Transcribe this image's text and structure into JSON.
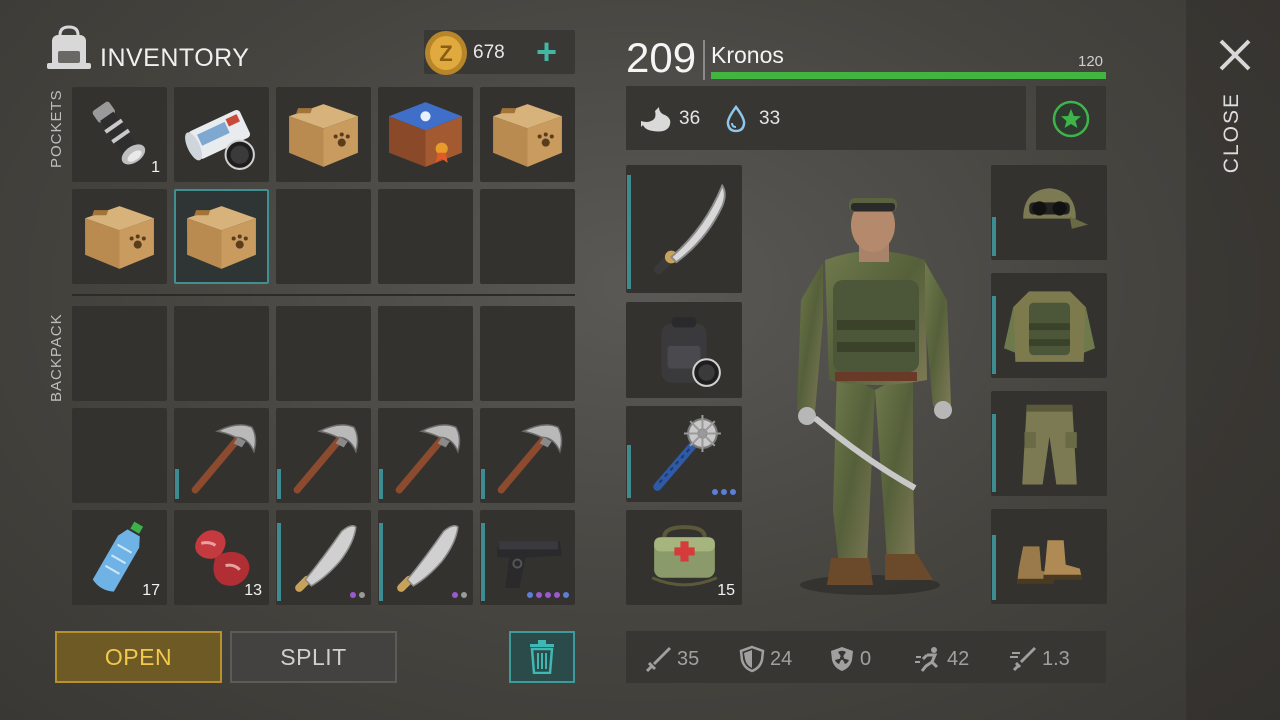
{
  "inventory": {
    "title": "INVENTORY",
    "pockets_label": "POCKETS",
    "backpack_label": "BACKPACK",
    "coins": "678",
    "coin_glyph": "Z",
    "pockets": [
      {
        "item": "flashlight-icon",
        "count": "1"
      },
      {
        "item": "map-scroll-icon",
        "count": ""
      },
      {
        "item": "cardboard-box-icon",
        "count": ""
      },
      {
        "item": "blue-crate-icon",
        "count": ""
      },
      {
        "item": "cardboard-box-icon",
        "count": ""
      },
      {
        "item": "cardboard-box-icon",
        "count": ""
      },
      {
        "item": "cardboard-box-icon",
        "count": "",
        "selected": true
      },
      {
        "item": "",
        "count": ""
      },
      {
        "item": "",
        "count": ""
      },
      {
        "item": "",
        "count": ""
      }
    ],
    "backpack": [
      {
        "item": "",
        "count": ""
      },
      {
        "item": "",
        "count": ""
      },
      {
        "item": "",
        "count": ""
      },
      {
        "item": "",
        "count": ""
      },
      {
        "item": "",
        "count": ""
      },
      {
        "item": "",
        "count": ""
      },
      {
        "item": "pickaxe-icon",
        "count": "",
        "durability": 0.35
      },
      {
        "item": "pickaxe-icon",
        "count": "",
        "durability": 0.35
      },
      {
        "item": "pickaxe-icon",
        "count": "",
        "durability": 0.35
      },
      {
        "item": "pickaxe-icon",
        "count": "",
        "durability": 0.35
      },
      {
        "item": "water-bottle-icon",
        "count": "17"
      },
      {
        "item": "raw-meat-icon",
        "count": "13"
      },
      {
        "item": "machete-icon",
        "count": "",
        "durability": 0.9,
        "dots": [
          "#9b59d0",
          "#9a9a9a"
        ]
      },
      {
        "item": "machete-icon",
        "count": "",
        "durability": 0.9,
        "dots": [
          "#9b59d0",
          "#9a9a9a"
        ]
      },
      {
        "item": "pistol-icon",
        "count": "",
        "durability": 0.9,
        "dots": [
          "#5b7fd6",
          "#9b59d0",
          "#9b59d0",
          "#9b59d0",
          "#5b7fd6"
        ]
      }
    ],
    "buttons": {
      "open": "OPEN",
      "split": "SPLIT"
    }
  },
  "character": {
    "level": "209",
    "name": "Kronos",
    "xp_value": "120",
    "xp_fraction": 1.0,
    "hunger": "36",
    "thirst": "33",
    "equipment_left": [
      {
        "item": "katana-icon",
        "count": "",
        "durability": 0.95
      },
      {
        "item": "backpack-icon",
        "count": ""
      },
      {
        "item": "spiked-mace-icon",
        "count": "",
        "durability": 0.6,
        "dots": [
          "#5b7fd6",
          "#5b7fd6",
          "#5b7fd6"
        ]
      },
      {
        "item": "medkit-bag-icon",
        "count": "15"
      }
    ],
    "equipment_right": [
      {
        "item": "camo-cap-icon",
        "durability": 0.45
      },
      {
        "item": "camo-vest-icon",
        "durability": 0.8
      },
      {
        "item": "camo-pants-icon",
        "durability": 0.8
      },
      {
        "item": "boots-icon",
        "durability": 0.75
      }
    ],
    "stats": {
      "attack": "35",
      "defense": "24",
      "radiation": "0",
      "speed": "42",
      "attack_speed": "1.3"
    }
  },
  "close_label": "CLOSE",
  "colors": {
    "accent_teal": "#3d8c91",
    "xp_green": "#41b53f",
    "open_gold": "#f2c94c"
  }
}
